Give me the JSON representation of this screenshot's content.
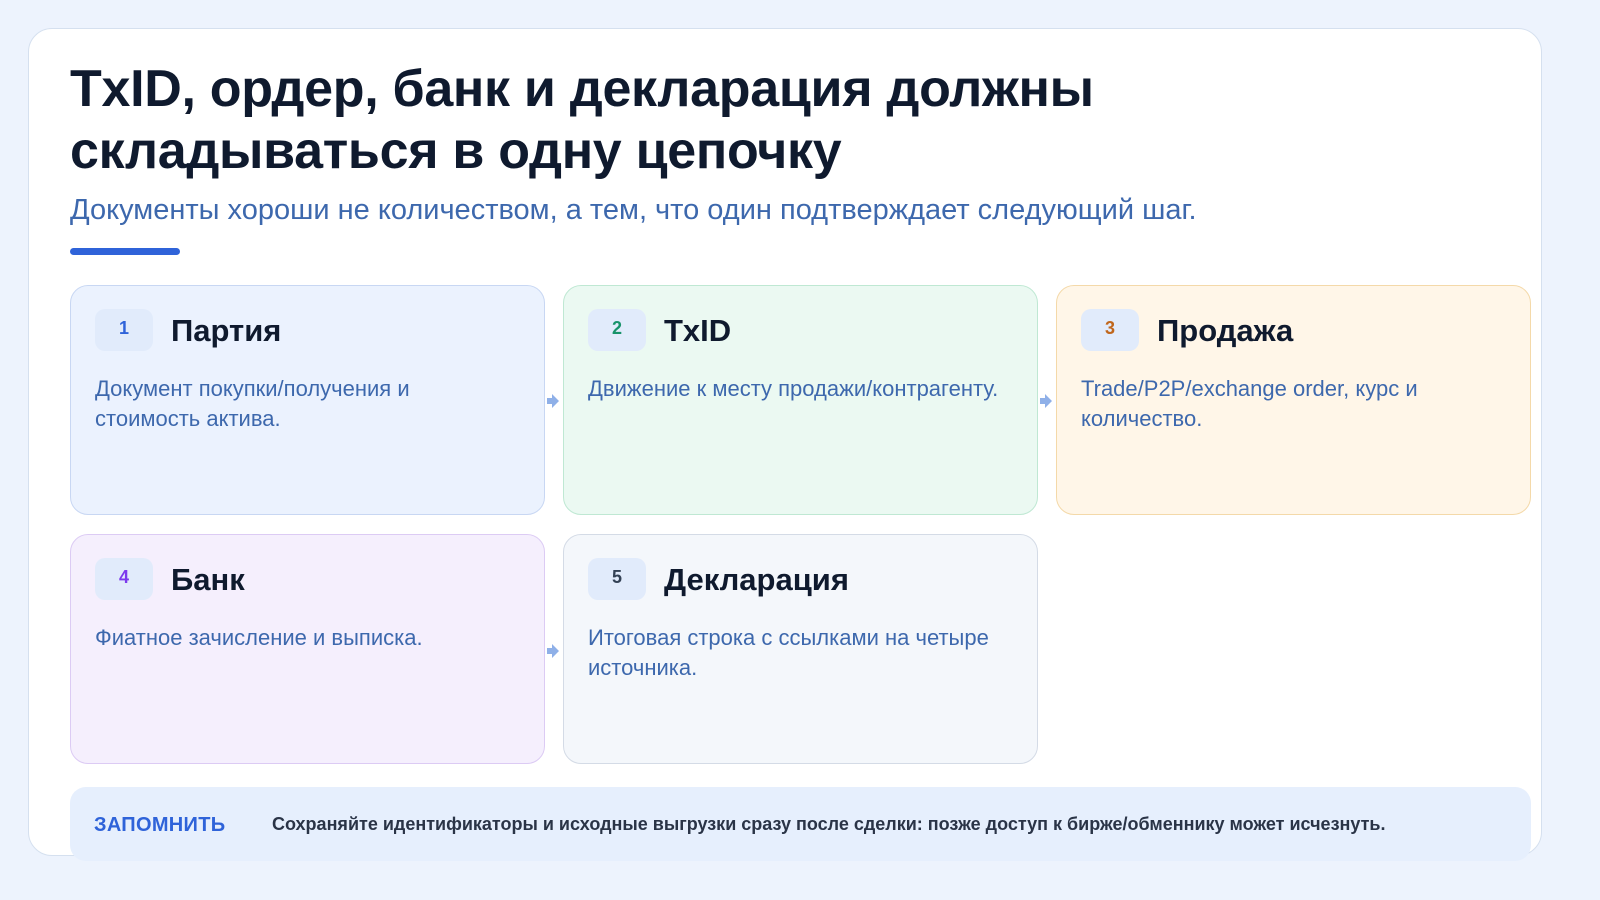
{
  "slide": {
    "title_line1": "TxID, ордер, банк и декларация должны",
    "title_line2": "складываться в одну цепочку",
    "subtitle": "Документы хороши не количеством, а тем, что один подтверждает следующий шаг."
  },
  "steps": [
    {
      "num": "1",
      "title": "Партия",
      "desc": "Документ покупки/получения и стоимость актива.",
      "num_color": "#2f63d9"
    },
    {
      "num": "2",
      "title": "TxID",
      "desc": "Движение к месту продажи/контрагенту.",
      "num_color": "#17936a"
    },
    {
      "num": "3",
      "title": "Продажа",
      "desc": "Trade/P2P/exchange order, курс и количество.",
      "num_color": "#c0661b"
    },
    {
      "num": "4",
      "title": "Банк",
      "desc": "Фиатное зачисление и выписка.",
      "num_color": "#7c3aed"
    },
    {
      "num": "5",
      "title": "Декларация",
      "desc": "Итоговая строка с ссылками на четыре источника.",
      "num_color": "#334155"
    }
  ],
  "note": {
    "label": "ЗАПОМНИТЬ",
    "text": "Сохраняйте идентификаторы и исходные выгрузки сразу после сделки: позже доступ к бирже/обменнику может исчезнуть."
  },
  "colors": {
    "accent": "#2f63d9",
    "title": "#0f1a2e",
    "subtitle": "#3d68ad",
    "arrow": "#8fb0e8"
  }
}
